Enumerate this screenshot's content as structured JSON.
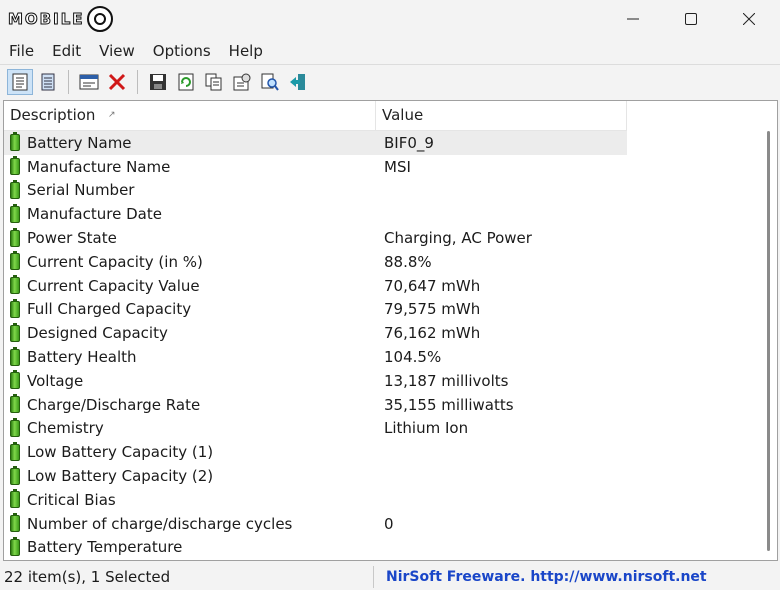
{
  "window": {
    "logo_text": "MOBILE",
    "minimize_icon": "minimize-icon",
    "maximize_icon": "maximize-icon",
    "close_icon": "close-icon"
  },
  "menu": [
    "File",
    "Edit",
    "View",
    "Options",
    "Help"
  ],
  "toolbar": {
    "buttons": [
      "html-report-icon",
      "html-report-all-icon",
      "properties-icon",
      "delete-icon",
      "save-icon",
      "refresh-icon",
      "copy-icon",
      "settings-icon",
      "find-icon",
      "exit-icon"
    ]
  },
  "list": {
    "columns": [
      "Description",
      "Value"
    ],
    "rows": [
      {
        "desc": "Battery Name",
        "value": "BIF0_9"
      },
      {
        "desc": "Manufacture Name",
        "value": "MSI"
      },
      {
        "desc": "Serial Number",
        "value": ""
      },
      {
        "desc": "Manufacture Date",
        "value": ""
      },
      {
        "desc": "Power State",
        "value": "Charging, AC Power"
      },
      {
        "desc": "Current Capacity (in %)",
        "value": "88.8%"
      },
      {
        "desc": "Current Capacity Value",
        "value": "70,647 mWh"
      },
      {
        "desc": "Full Charged Capacity",
        "value": "79,575 mWh"
      },
      {
        "desc": "Designed Capacity",
        "value": "76,162 mWh"
      },
      {
        "desc": "Battery Health",
        "value": "104.5%"
      },
      {
        "desc": "Voltage",
        "value": "13,187 millivolts"
      },
      {
        "desc": "Charge/Discharge Rate",
        "value": "35,155 milliwatts"
      },
      {
        "desc": "Chemistry",
        "value": "Lithium Ion"
      },
      {
        "desc": "Low Battery Capacity (1)",
        "value": ""
      },
      {
        "desc": "Low Battery Capacity (2)",
        "value": ""
      },
      {
        "desc": "Critical Bias",
        "value": ""
      },
      {
        "desc": "Number of charge/discharge cycles",
        "value": "0"
      },
      {
        "desc": "Battery Temperature",
        "value": ""
      }
    ]
  },
  "status": {
    "items": "22 item(s), 1 Selected",
    "credit": "NirSoft Freeware.  http://www.nirsoft.net"
  }
}
